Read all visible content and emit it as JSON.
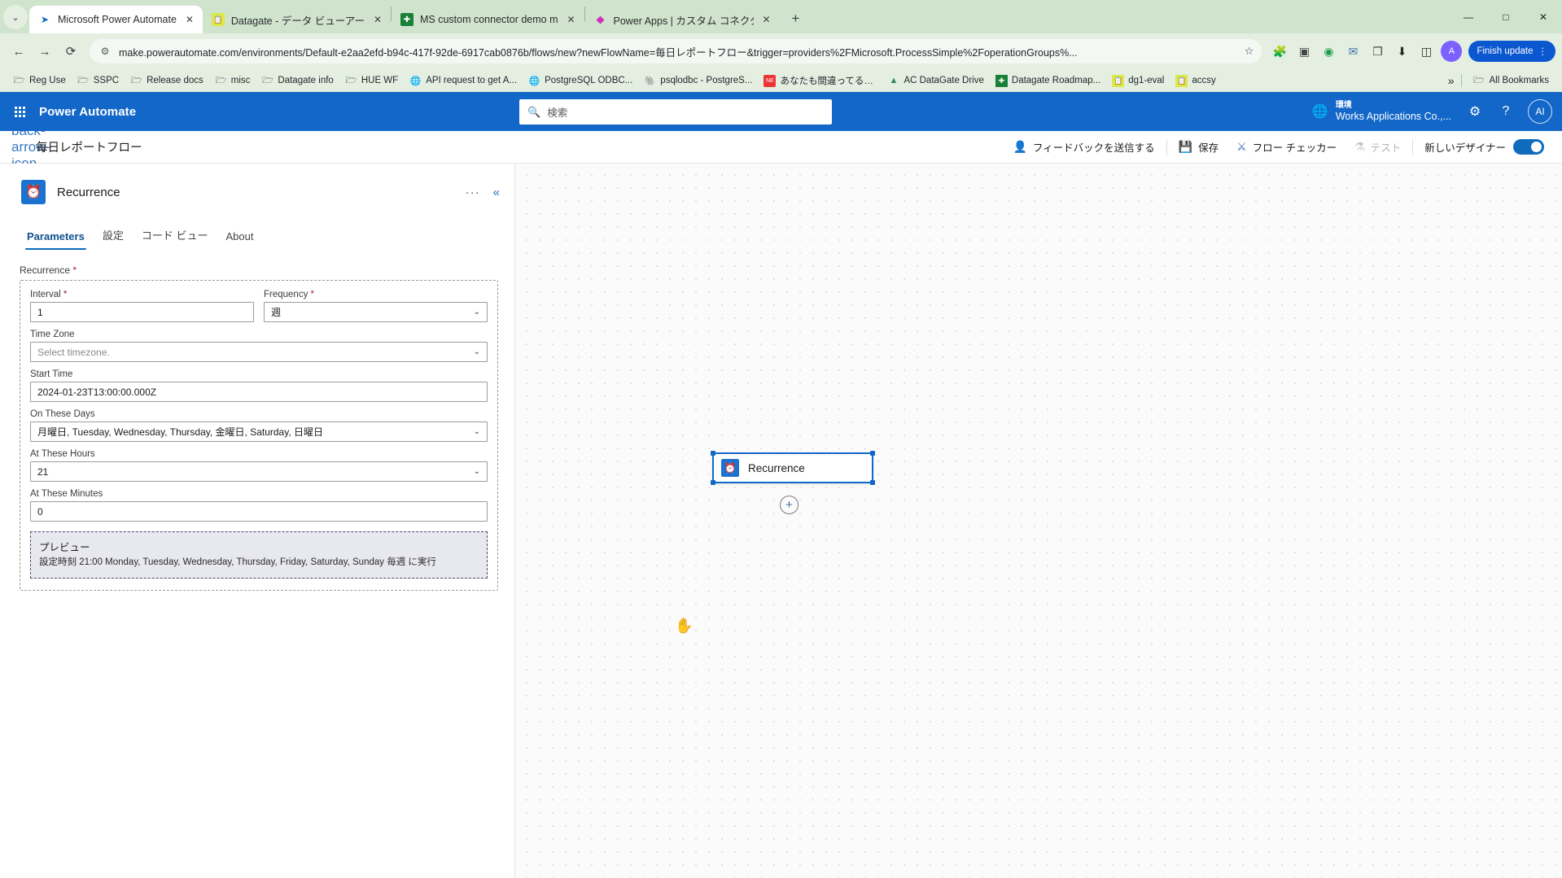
{
  "browser": {
    "tabs": [
      {
        "title": "Microsoft Power Automate",
        "favicon": "power-automate-icon",
        "active": true,
        "close": "✕"
      },
      {
        "title": "Datagate - データ ビューアー",
        "favicon": "datagate-icon",
        "active": false,
        "close": "✕"
      },
      {
        "title": "MS custom connector demo m",
        "favicon": "sheets-icon",
        "active": false,
        "close": "✕"
      },
      {
        "title": "Power Apps | カスタム コネクタ",
        "favicon": "power-apps-icon",
        "active": false,
        "close": "✕"
      }
    ],
    "new_tab_label": "+",
    "tab_list_chevron": "⌄",
    "window_controls": {
      "minimize": "—",
      "maximize": "□",
      "close": "✕"
    },
    "nav": {
      "back": "←",
      "forward": "→",
      "reload": "⟳"
    },
    "omnibox": {
      "site_icon": "tune-icon",
      "url": "make.powerautomate.com/environments/Default-e2aa2efd-b94c-417f-92de-6917cab0876b/flows/new?newFlowName=毎日レポートフロー&trigger=providers%2FMicrosoft.ProcessSimple%2FoperationGroups%...",
      "star": "☆"
    },
    "extensions": [
      "puzzle-icon",
      "screenshot-icon",
      "grammar-icon",
      "mail-icon",
      "collections-icon"
    ],
    "downloads_icon": "download-icon",
    "sidepanel_icon": "sidepanel-icon",
    "profile_initial": "A",
    "finish_update": {
      "label": "Finish update",
      "menu": "⋮"
    },
    "bookmarks": [
      {
        "label": "Reg Use",
        "icon": "folder-icon"
      },
      {
        "label": "SSPC",
        "icon": "folder-icon"
      },
      {
        "label": "Release docs",
        "icon": "folder-icon"
      },
      {
        "label": "misc",
        "icon": "folder-icon"
      },
      {
        "label": "Datagate info",
        "icon": "folder-icon"
      },
      {
        "label": "HUE WF",
        "icon": "folder-icon"
      },
      {
        "label": "API request to get A...",
        "icon": "globe-icon"
      },
      {
        "label": "PostgreSQL ODBC...",
        "icon": "globe-icon"
      },
      {
        "label": "psqlodbc - PostgreS...",
        "icon": "postgres-icon"
      },
      {
        "label": "あなたも間違ってるかも...",
        "icon": "next-icon"
      },
      {
        "label": "AC DataGate Drive",
        "icon": "drive-icon"
      },
      {
        "label": "Datagate Roadmap...",
        "icon": "sheets-icon"
      },
      {
        "label": "dg1-eval",
        "icon": "datagate-icon"
      },
      {
        "label": "accsy",
        "icon": "datagate-icon"
      }
    ],
    "bookmarks_overflow": "»",
    "all_bookmarks": {
      "label": "All Bookmarks",
      "icon": "folder-icon"
    }
  },
  "app_header": {
    "waffle": "app-launcher-icon",
    "brand": "Power Automate",
    "search": {
      "placeholder": "検索",
      "icon": "search-icon"
    },
    "environment": {
      "icon": "environment-icon",
      "label": "環境",
      "name": "Works Applications Co.,..."
    },
    "settings_icon": "gear-icon",
    "help_icon": "help-icon",
    "avatar_initials": "AI"
  },
  "command_bar": {
    "back_icon": "back-arrow-icon",
    "flow_name": "毎日レポートフロー",
    "feedback": {
      "label": "フィードバックを送信する",
      "icon": "feedback-person-icon"
    },
    "save": {
      "label": "保存",
      "icon": "save-disk-icon"
    },
    "flow_checker": {
      "label": "フロー チェッカー",
      "icon": "stethoscope-icon"
    },
    "test": {
      "label": "テスト",
      "icon": "flask-icon",
      "disabled": true
    },
    "new_designer": {
      "label": "新しいデザイナー",
      "on": true
    }
  },
  "panel": {
    "node_icon": "alarm-clock-icon",
    "node_title": "Recurrence",
    "more_actions": "···",
    "collapse": "«",
    "tabs": [
      {
        "label": "Parameters",
        "selected": true
      },
      {
        "label": "設定",
        "selected": false
      },
      {
        "label": "コード ビュー",
        "selected": false
      },
      {
        "label": "About",
        "selected": false
      }
    ],
    "group_label": "Recurrence",
    "group_required": "*",
    "fields": {
      "interval": {
        "label": "Interval",
        "required": "*",
        "value": "1",
        "type": "text"
      },
      "frequency": {
        "label": "Frequency",
        "required": "*",
        "value": "週",
        "type": "select",
        "chevron": "⌄"
      },
      "time_zone": {
        "label": "Time Zone",
        "value": "",
        "placeholder": "Select timezone.",
        "type": "select",
        "chevron": "⌄"
      },
      "start_time": {
        "label": "Start Time",
        "value": "2024-01-23T13:00:00.000Z",
        "type": "text"
      },
      "on_these_days": {
        "label": "On These Days",
        "value": "月曜日, Tuesday, Wednesday, Thursday, 金曜日, Saturday, 日曜日",
        "type": "select",
        "chevron": "⌄"
      },
      "at_these_hours": {
        "label": "At These Hours",
        "value": "21",
        "type": "select",
        "chevron": "⌄"
      },
      "at_these_minutes": {
        "label": "At These Minutes",
        "value": "0",
        "type": "text"
      }
    },
    "preview": {
      "title": "プレビュー",
      "text": "設定時刻 21:00 Monday, Tuesday, Wednesday, Thursday, Friday, Saturday, Sunday 毎週 に実行"
    }
  },
  "canvas": {
    "node": {
      "icon": "alarm-clock-icon",
      "label": "Recurrence"
    },
    "add_step_icon": "plus-icon",
    "cursor": "hand-cursor"
  },
  "colors": {
    "brand_blue": "#1267c8",
    "chrome_green": "#cfe3cd",
    "accent_link": "#2b6cb8",
    "required_red": "#a4262c"
  }
}
